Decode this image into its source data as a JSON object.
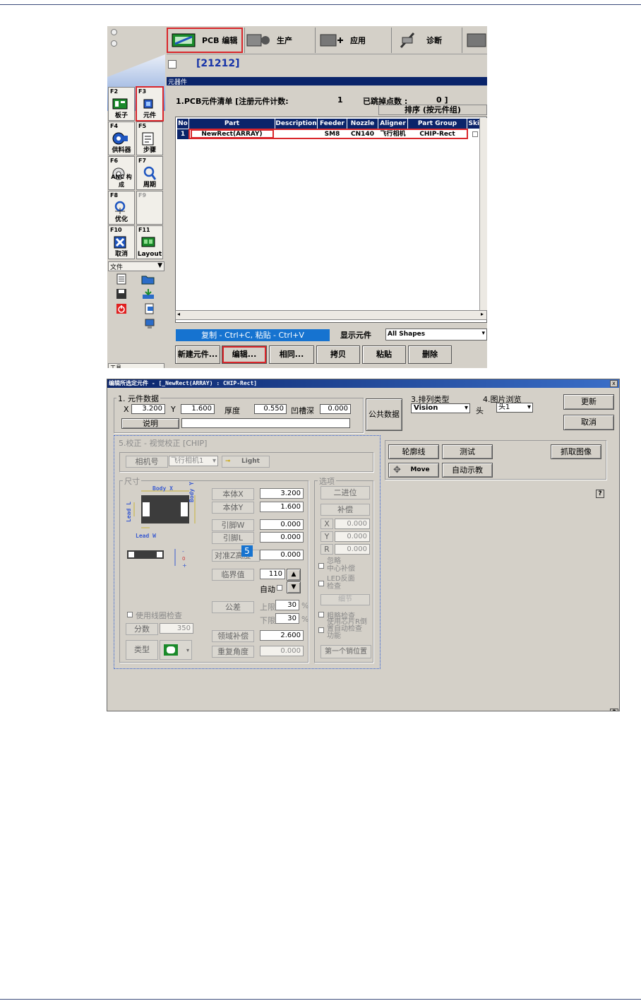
{
  "toolbar": {
    "pcb_edit": "PCB 编辑",
    "production": "生产",
    "application": "应用",
    "diagnosis": "诊断"
  },
  "title_number": "[21212]",
  "components_header": "元器件",
  "pcb_list": {
    "label": "1.PCB元件清单 [注册元件计数:",
    "count": "1",
    "skip_label": "已跳掉点数 :",
    "skip_value": "0 ]",
    "sort_button": "排序 (按元件组)"
  },
  "grid": {
    "headers": [
      "No",
      "Part",
      "Description",
      "Feeder",
      "Nozzle",
      "Aligner",
      "Part Group",
      "Skip"
    ],
    "rows": [
      {
        "no": "1",
        "part": "NewRect(ARRAY)",
        "description": "",
        "feeder": "SM8",
        "nozzle": "CN140",
        "aligner": "飞行相机",
        "part_group": "CHIP-Rect",
        "skip": ""
      }
    ]
  },
  "sidebar": {
    "keys": [
      {
        "key": "F2",
        "label": "板子"
      },
      {
        "key": "F3",
        "label": "元件"
      },
      {
        "key": "F4",
        "label": "供料器"
      },
      {
        "key": "F5",
        "label": "步骤"
      },
      {
        "key": "F6",
        "label": "ANC 构成"
      },
      {
        "key": "F7",
        "label": "周期"
      },
      {
        "key": "F8",
        "label": "优化"
      },
      {
        "key": "F9",
        "label": ""
      },
      {
        "key": "F10",
        "label": "取消"
      },
      {
        "key": "F11",
        "label": "Layout"
      }
    ],
    "file_menu": "文件",
    "tool_menu": "工具"
  },
  "copy_hint": "复制 - Ctrl+C, 粘贴 - Ctrl+V",
  "show_label": "显示元件",
  "show_value": "All Shapes",
  "bottom_buttons": [
    "新建元件...",
    "编辑...",
    "相同...",
    "拷贝",
    "粘贴",
    "删除"
  ],
  "dialog": {
    "title": "编辑所选定元件 - [_NewRect(ARRAY) : CHIP-Rect]",
    "close": "x",
    "section1": "1. 元件数据",
    "x_label": "X",
    "x_value": "3.200",
    "y_label": "Y",
    "y_value": "1.600",
    "thickness_label": "厚度",
    "thickness_value": "0.550",
    "groove_label": "凹槽深",
    "groove_value": "0.000",
    "desc_label": "说明",
    "desc_value": "",
    "common_data": "公共数据",
    "arrange_label": "3.排列类型",
    "arrange_value": "Vision",
    "image_label": "4.图片浏览",
    "head_label": "头",
    "head_value": "头1",
    "update": "更新",
    "cancel": "取消",
    "outline": "轮廓线",
    "test": "测试",
    "capture": "抓取图像",
    "move": "Move",
    "auto_teach": "自动示教",
    "help": "?",
    "vision": {
      "title": "5.校正 - 视觉校正 [CHIP]",
      "camera_label": "相机号",
      "camera_value": "飞行相机1",
      "light": "Light",
      "size_group": "尺寸",
      "body_x": "Body X",
      "body_y": "Body Y",
      "lead_l": "Lead L",
      "lead_w": "Lead W",
      "fields": [
        {
          "label": "本体X",
          "value": "3.200"
        },
        {
          "label": "本体Y",
          "value": "1.600"
        },
        {
          "label": "引脚W",
          "value": "0.000"
        },
        {
          "label": "引脚L",
          "value": "0.000"
        },
        {
          "label": "对准Z高度",
          "value": "0.000"
        },
        {
          "label": "临界值",
          "value": "110"
        }
      ],
      "auto_label": "自动",
      "tolerance_label": "公差",
      "upper_label": "上限",
      "upper_value": "30",
      "lower_label": "下限",
      "lower_value": "30",
      "percent": "%",
      "use_coil": "使用线圈检查",
      "score_label": "分数",
      "score_value": "350",
      "type_label": "类型",
      "area_comp_label": "领域补偿",
      "area_comp_value": "2.600",
      "repeat_angle_label": "重复角度",
      "repeat_angle_value": "0.000",
      "badge": "5",
      "options_group": "选项",
      "binary": "二进位",
      "compensate": "补偿",
      "comp_x": "X",
      "comp_y": "Y",
      "comp_r": "R",
      "comp_x_value": "0.000",
      "comp_y_value": "0.000",
      "comp_r_value": "0.000",
      "ignore_center_1": "忽略",
      "ignore_center_2": "中心补偿",
      "led_back_1": "LED反面",
      "led_back_2": "检查",
      "detail": "细节",
      "rough_check": "粗略检查",
      "use_chip_1": "使用芯片R倒",
      "use_chip_2": "置自动检查",
      "use_chip_3": "功能",
      "first_pin": "第一个销位置"
    }
  },
  "colors": {
    "accent": "#0a246a",
    "highlight": "#d9262b",
    "copy_bar": "#1673d0"
  }
}
